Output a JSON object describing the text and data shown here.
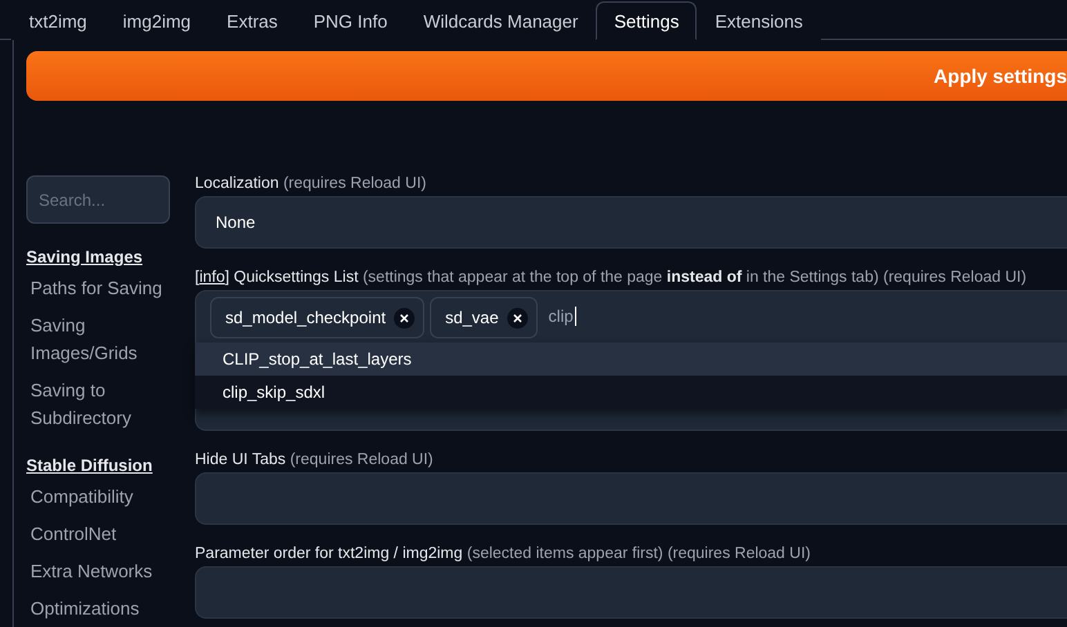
{
  "tabs": [
    {
      "label": "txt2img",
      "selected": false
    },
    {
      "label": "img2img",
      "selected": false
    },
    {
      "label": "Extras",
      "selected": false
    },
    {
      "label": "PNG Info",
      "selected": false
    },
    {
      "label": "Wildcards Manager",
      "selected": false
    },
    {
      "label": "Settings",
      "selected": true
    },
    {
      "label": "Extensions",
      "selected": false
    }
  ],
  "apply_button": "Apply settings",
  "sidebar": {
    "search": {
      "placeholder": "Search..."
    },
    "groups": [
      {
        "heading": "Saving Images",
        "items": [
          "Paths for Saving",
          "Saving Images/Grids",
          "Saving to Subdirectory"
        ]
      },
      {
        "heading": "Stable Diffusion",
        "items": [
          "Compatibility",
          "ControlNet",
          "Extra Networks",
          "Optimizations"
        ]
      }
    ]
  },
  "settings": [
    {
      "kind": "dropdown",
      "label": "Localization",
      "hint": "(requires Reload UI)",
      "value": "None"
    },
    {
      "kind": "multiselect",
      "prefix": "[",
      "link": "info",
      "label": "] Quicksettings List",
      "hint": "(settings that appear at the top of the page **instead of** in the Settings tab) (requires Reload UI)",
      "chips": [
        "sd_model_checkpoint",
        "sd_vae"
      ],
      "value": "clip",
      "options": [
        {
          "label": "CLIP_stop_at_last_layers",
          "selected": true
        },
        {
          "label": "clip_skip_sdxl",
          "selected": false
        }
      ]
    },
    {
      "kind": "empty",
      "label": "Hide UI Tabs",
      "hint": "(requires Reload UI)"
    },
    {
      "kind": "empty",
      "label": "Parameter order for txt2img / img2img",
      "hint": "(selected items appear first) (requires Reload UI)"
    }
  ]
}
